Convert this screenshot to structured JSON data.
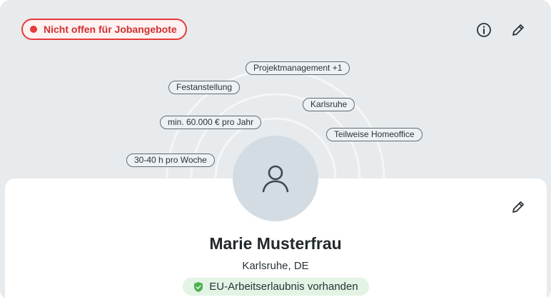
{
  "status_badge": {
    "label": "Nicht offen für Jobangebote",
    "color": "#e53a3a"
  },
  "header_actions": {
    "info_icon": "info-circle-icon",
    "edit_icon": "pencil-icon"
  },
  "chips": [
    {
      "label": "Projektmanagement +1"
    },
    {
      "label": "Festanstellung"
    },
    {
      "label": "Karlsruhe"
    },
    {
      "label": "min. 60.000 € pro Jahr"
    },
    {
      "label": "Teilweise Homeoffice"
    },
    {
      "label": "30-40 h pro Woche"
    }
  ],
  "profile": {
    "avatar_icon": "user-icon",
    "name": "Marie Musterfrau",
    "location": "Karlsruhe, DE",
    "work_permit": {
      "label": "EU-Arbeitserlaubnis vorhanden",
      "icon": "shield-check-icon",
      "color": "#4caf50"
    },
    "edit_icon": "pencil-icon"
  }
}
